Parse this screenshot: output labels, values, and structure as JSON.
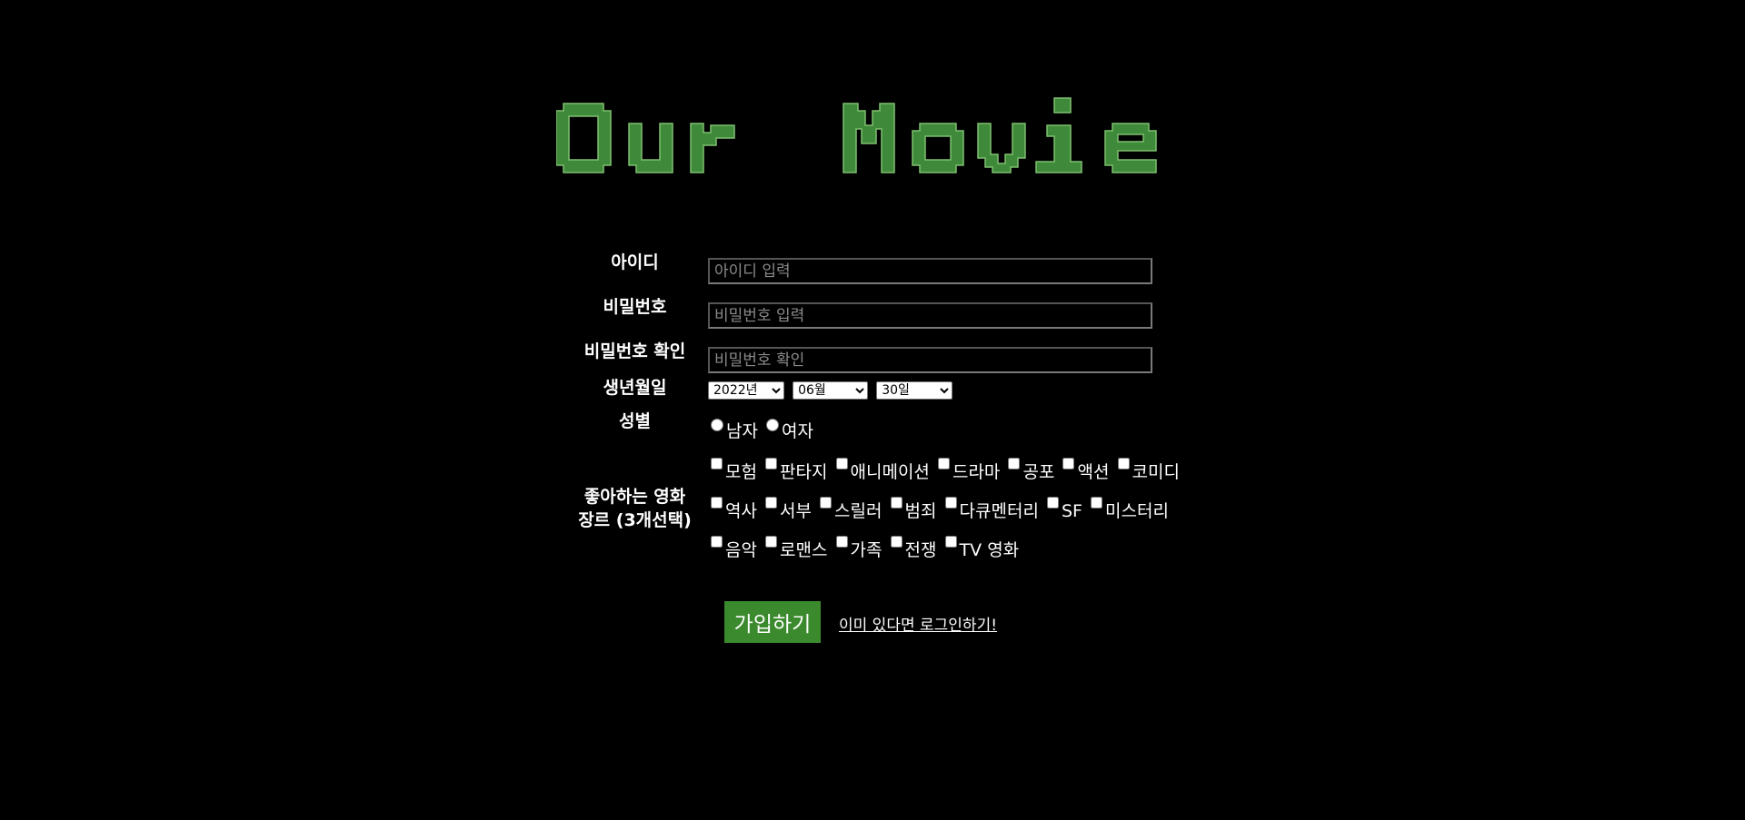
{
  "logo": {
    "text": "Our Movie",
    "color": "#3f8a3a"
  },
  "form": {
    "id_label": "아이디",
    "id_placeholder": "아이디 입력",
    "pw_label": "비밀번호",
    "pw_placeholder": "비밀번호 입력",
    "pw_confirm_label": "비밀번호 확인",
    "pw_confirm_placeholder": "비밀번호 확인",
    "birth_label": "생년월일",
    "birth_year": "2022년",
    "birth_month": "06월",
    "birth_day": "30일",
    "gender_label": "성별",
    "gender_male": "남자",
    "gender_female": "여자",
    "genre_label_line1": "좋아하는 영화",
    "genre_label_line2": "장르 (3개선택)",
    "genres": [
      "모험",
      "판타지",
      "애니메이션",
      "드라마",
      "공포",
      "액션",
      "코미디",
      "역사",
      "서부",
      "스릴러",
      "범죄",
      "다큐멘터리",
      "SF",
      "미스터리",
      "음악",
      "로맨스",
      "가족",
      "전쟁",
      "TV 영화"
    ],
    "submit_label": "가입하기",
    "login_link": "이미 있다면 로그인하기!"
  },
  "colors": {
    "accent": "#3c8a2e",
    "background": "#000000"
  }
}
